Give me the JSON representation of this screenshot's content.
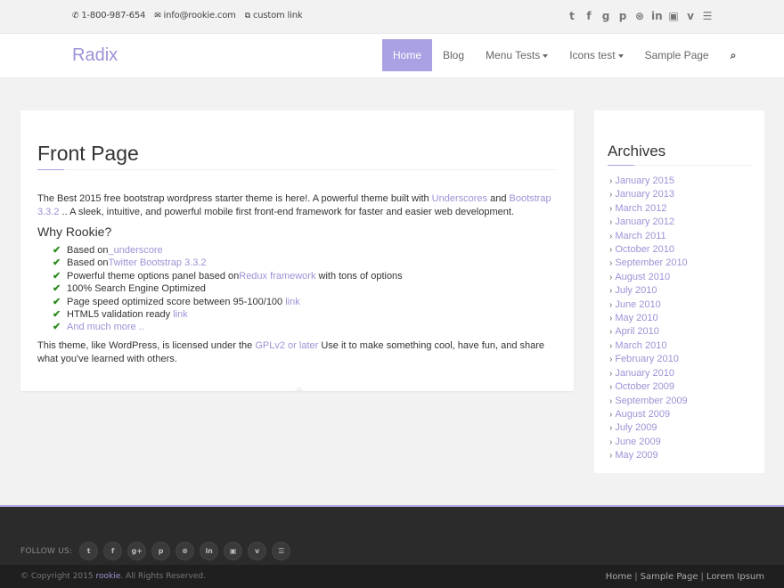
{
  "topbar": {
    "phone": "1-800-987-654",
    "email": "info@rookie.com",
    "custom_link": "custom link",
    "social_icons": [
      "twitter-icon",
      "facebook-icon",
      "google-plus-icon",
      "pinterest-icon",
      "dribbble-icon",
      "linkedin-icon",
      "flickr-icon",
      "vimeo-icon",
      "rss-icon"
    ]
  },
  "navbar": {
    "brand": "Radix",
    "items": [
      {
        "label": "Home",
        "active": true
      },
      {
        "label": "Blog"
      },
      {
        "label": "Menu Tests",
        "dropdown": true
      },
      {
        "label": "Icons test",
        "dropdown": true
      },
      {
        "label": "Sample Page"
      }
    ]
  },
  "main": {
    "title": "Front Page",
    "intro_1": "The Best 2015 free bootstrap wordpress starter theme is here!. A powerful theme built with ",
    "intro_link_1": "Underscores",
    "intro_2": " and ",
    "intro_link_2": "Bootstrap 3.3.2",
    "intro_3": " .. A sleek, intuitive, and powerful mobile first front-end framework for faster and easier web development.",
    "subtitle": "Why Rookie?",
    "features": [
      {
        "pre": "Based on ",
        "link": "_underscore",
        "post": ""
      },
      {
        "pre": "Based on ",
        "link": "Twitter Bootstrap 3.3.2",
        "post": ""
      },
      {
        "pre": "Powerful theme options panel based on ",
        "link": "Redux framework",
        "post": " with tons of options"
      },
      {
        "pre": "100% Search Engine Optimized",
        "link": "",
        "post": ""
      },
      {
        "pre": "Page speed optimized score between 95-100/100 ",
        "link": "link",
        "post": ""
      },
      {
        "pre": "HTML5 validation ready ",
        "link": "link",
        "post": ""
      },
      {
        "pre": "",
        "link": "And much more ..",
        "post": ""
      }
    ],
    "outro_1": "This theme, like WordPress, is licensed under the ",
    "outro_link": "GPLv2 or later",
    "outro_2": " Use it to make something cool, have fun, and share what you've learned with others."
  },
  "sidebar": {
    "title": "Archives",
    "archives": [
      "January 2015",
      "January 2013",
      "March 2012",
      "January 2012",
      "March 2011",
      "October 2010",
      "September 2010",
      "August 2010",
      "July 2010",
      "June 2010",
      "May 2010",
      "April 2010",
      "March 2010",
      "February 2010",
      "January 2010",
      "October 2009",
      "September 2009",
      "August 2009",
      "July 2009",
      "June 2009",
      "May 2009"
    ]
  },
  "footer": {
    "follow_label": "FOLLOW US:",
    "social_icons": [
      "twitter-icon",
      "facebook-icon",
      "google-plus-icon",
      "pinterest-icon",
      "dribbble-icon",
      "linkedin-icon",
      "flickr-icon",
      "vimeo-icon",
      "rss-icon"
    ],
    "copyright_1": "© Copyright 2015 ",
    "copyright_link": "rookie",
    "copyright_2": ". All Rights Reserved.",
    "links": [
      "Home",
      "Sample Page",
      "Lorem Ipsum"
    ]
  },
  "colors": {
    "accent": "#a9a1e3",
    "link": "#9b93d6",
    "footer_bg": "#2b2b2b"
  }
}
